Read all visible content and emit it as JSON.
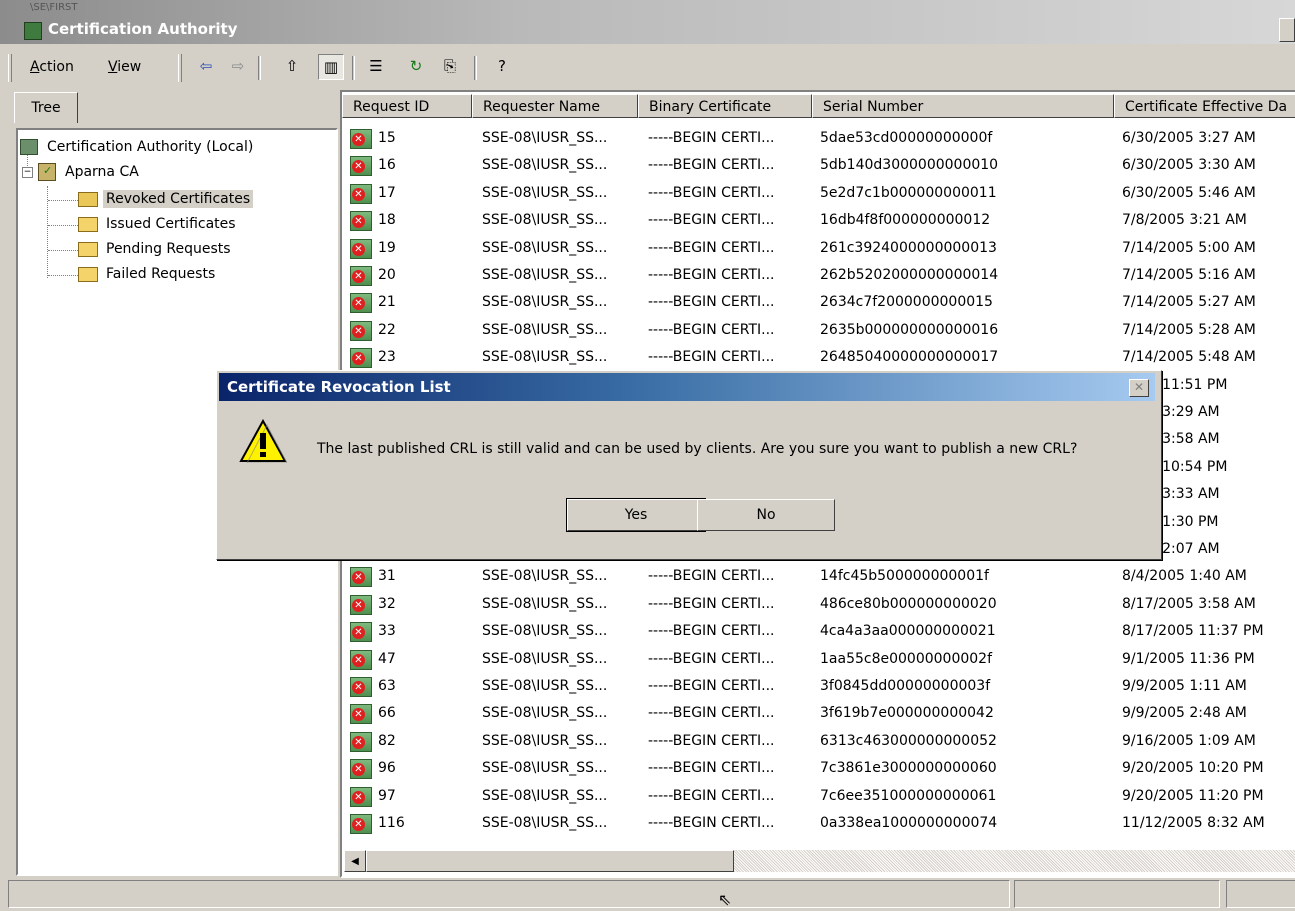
{
  "window": {
    "title": "Certification Authority",
    "top_strip": "\\SE\\FIRST"
  },
  "menu": {
    "action": {
      "label_pre": "",
      "accel": "A",
      "label_post": "ction"
    },
    "view": {
      "label_pre": "",
      "accel": "V",
      "label_post": "iew"
    }
  },
  "toolbar": {
    "icons": [
      "back-arrow-icon",
      "forward-arrow-icon",
      "up-folder-icon",
      "show-tree-icon",
      "properties-icon",
      "refresh-icon",
      "export-list-icon",
      "help-icon"
    ]
  },
  "tree": {
    "tab_label": "Tree",
    "root": "Certification Authority (Local)",
    "ca": "Aparna CA",
    "folders": [
      "Revoked Certificates",
      "Issued Certificates",
      "Pending Requests",
      "Failed Requests"
    ],
    "selected": "Revoked Certificates"
  },
  "list": {
    "columns": [
      "Request ID",
      "Requester Name",
      "Binary Certificate",
      "Serial Number",
      "Certificate Effective Da"
    ],
    "rows": [
      {
        "id": "15",
        "requester": "SSE-08\\IUSR_SS...",
        "binary": "-----BEGIN CERTI...",
        "serial": "5dae53cd00000000000f",
        "effective": "6/30/2005 3:27 AM"
      },
      {
        "id": "16",
        "requester": "SSE-08\\IUSR_SS...",
        "binary": "-----BEGIN CERTI...",
        "serial": "5db140d3000000000010",
        "effective": "6/30/2005 3:30 AM"
      },
      {
        "id": "17",
        "requester": "SSE-08\\IUSR_SS...",
        "binary": "-----BEGIN CERTI...",
        "serial": "5e2d7c1b000000000011",
        "effective": "6/30/2005 5:46 AM"
      },
      {
        "id": "18",
        "requester": "SSE-08\\IUSR_SS...",
        "binary": "-----BEGIN CERTI...",
        "serial": "16db4f8f000000000012",
        "effective": "7/8/2005 3:21 AM"
      },
      {
        "id": "19",
        "requester": "SSE-08\\IUSR_SS...",
        "binary": "-----BEGIN CERTI...",
        "serial": "261c3924000000000013",
        "effective": "7/14/2005 5:00 AM"
      },
      {
        "id": "20",
        "requester": "SSE-08\\IUSR_SS...",
        "binary": "-----BEGIN CERTI...",
        "serial": "262b5202000000000014",
        "effective": "7/14/2005 5:16 AM"
      },
      {
        "id": "21",
        "requester": "SSE-08\\IUSR_SS...",
        "binary": "-----BEGIN CERTI...",
        "serial": "2634c7f2000000000015",
        "effective": "7/14/2005 5:27 AM"
      },
      {
        "id": "22",
        "requester": "SSE-08\\IUSR_SS...",
        "binary": "-----BEGIN CERTI...",
        "serial": "2635b000000000000016",
        "effective": "7/14/2005 5:28 AM"
      },
      {
        "id": "23",
        "requester": "SSE-08\\IUSR_SS...",
        "binary": "-----BEGIN CERTI...",
        "serial": "26485040000000000017",
        "effective": "7/14/2005 5:48 AM"
      },
      {
        "id": "",
        "requester": "",
        "binary": "",
        "serial": "",
        "effective": "2005 11:51 PM"
      },
      {
        "id": "",
        "requester": "",
        "binary": "",
        "serial": "",
        "effective": "2005 3:29 AM"
      },
      {
        "id": "",
        "requester": "",
        "binary": "",
        "serial": "",
        "effective": "2005 3:58 AM"
      },
      {
        "id": "",
        "requester": "",
        "binary": "",
        "serial": "",
        "effective": "2005 10:54 PM"
      },
      {
        "id": "",
        "requester": "",
        "binary": "",
        "serial": "",
        "effective": "2005 3:33 AM"
      },
      {
        "id": "",
        "requester": "",
        "binary": "",
        "serial": "",
        "effective": "005 11:30 PM"
      },
      {
        "id": "",
        "requester": "",
        "binary": "",
        "serial": "",
        "effective": "005 12:07 AM"
      },
      {
        "id": "31",
        "requester": "SSE-08\\IUSR_SS...",
        "binary": "-----BEGIN CERTI...",
        "serial": "14fc45b500000000001f",
        "effective": "8/4/2005 1:40 AM"
      },
      {
        "id": "32",
        "requester": "SSE-08\\IUSR_SS...",
        "binary": "-----BEGIN CERTI...",
        "serial": "486ce80b000000000020",
        "effective": "8/17/2005 3:58 AM"
      },
      {
        "id": "33",
        "requester": "SSE-08\\IUSR_SS...",
        "binary": "-----BEGIN CERTI...",
        "serial": "4ca4a3aa000000000021",
        "effective": "8/17/2005 11:37 PM"
      },
      {
        "id": "47",
        "requester": "SSE-08\\IUSR_SS...",
        "binary": "-----BEGIN CERTI...",
        "serial": "1aa55c8e00000000002f",
        "effective": "9/1/2005 11:36 PM"
      },
      {
        "id": "63",
        "requester": "SSE-08\\IUSR_SS...",
        "binary": "-----BEGIN CERTI...",
        "serial": "3f0845dd00000000003f",
        "effective": "9/9/2005 1:11 AM"
      },
      {
        "id": "66",
        "requester": "SSE-08\\IUSR_SS...",
        "binary": "-----BEGIN CERTI...",
        "serial": "3f619b7e000000000042",
        "effective": "9/9/2005 2:48 AM"
      },
      {
        "id": "82",
        "requester": "SSE-08\\IUSR_SS...",
        "binary": "-----BEGIN CERTI...",
        "serial": "6313c463000000000052",
        "effective": "9/16/2005 1:09 AM"
      },
      {
        "id": "96",
        "requester": "SSE-08\\IUSR_SS...",
        "binary": "-----BEGIN CERTI...",
        "serial": "7c3861e3000000000060",
        "effective": "9/20/2005 10:20 PM"
      },
      {
        "id": "97",
        "requester": "SSE-08\\IUSR_SS...",
        "binary": "-----BEGIN CERTI...",
        "serial": "7c6ee351000000000061",
        "effective": "9/20/2005 11:20 PM"
      },
      {
        "id": "116",
        "requester": "SSE-08\\IUSR_SS...",
        "binary": "-----BEGIN CERTI...",
        "serial": "0a338ea1000000000074",
        "effective": "11/12/2005 8:32 AM"
      }
    ]
  },
  "dialog": {
    "title": "Certificate Revocation List",
    "message": "The last published CRL is still valid and can be used by clients. Are you sure you want to publish a new CRL?",
    "yes_label": "Yes",
    "no_label": "No",
    "icon": "warning-icon"
  },
  "status": {
    "cells": [
      "",
      "",
      ""
    ]
  }
}
